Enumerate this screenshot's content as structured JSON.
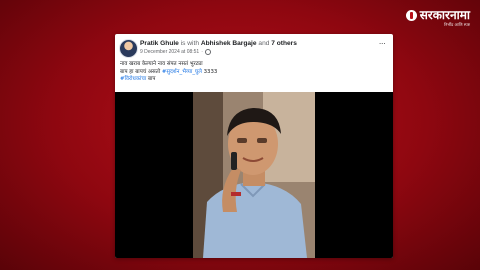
{
  "brand": {
    "logo_text": "सरकारनामा",
    "tagline": "निर्भीड आणि स्पष्ट"
  },
  "post": {
    "author": "Pratik Ghule",
    "with_text": "is with",
    "tagged_person": "Abhishek Bargaje",
    "and_text": "and",
    "others": "7 others",
    "timestamp": "9 December 2024 at 08:51",
    "privacy_icon": "globe-icon",
    "more_label": "···",
    "text": {
      "line1": "नाव खराब केल्याने नाव संपत नसतं भुरट्या",
      "line2_prefix": "बाप हा बापचं असतो",
      "line2_hashtag": "#सुदर्शन_भैय्या_घुले",
      "line2_suffix": "3333",
      "line3_hashtag": "#विरोधकांचा",
      "line3_suffix": "बाप"
    }
  },
  "colors": {
    "background": "#a00b15",
    "hashtag": "#1b74e4",
    "card": "#ffffff"
  }
}
